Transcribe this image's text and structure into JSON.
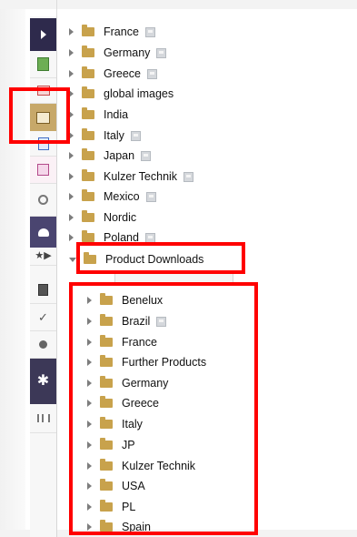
{
  "tree": {
    "top_items": [
      {
        "label": "France",
        "locked": true
      },
      {
        "label": "Germany",
        "locked": true
      },
      {
        "label": "Greece",
        "locked": true
      },
      {
        "label": "global images",
        "locked": false
      },
      {
        "label": "India",
        "locked": false
      },
      {
        "label": "Italy",
        "locked": true
      },
      {
        "label": "Japan",
        "locked": true
      },
      {
        "label": "Kulzer Technik",
        "locked": true
      },
      {
        "label": "Mexico",
        "locked": true
      },
      {
        "label": "Nordic",
        "locked": false
      },
      {
        "label": "Poland",
        "locked": true
      }
    ],
    "expanded_folder": {
      "label": "Product Downloads",
      "expanded": true
    },
    "sub_items": [
      {
        "label": "Benelux",
        "locked": false
      },
      {
        "label": "Brazil",
        "locked": true
      },
      {
        "label": "France",
        "locked": false
      },
      {
        "label": "Further Products",
        "locked": false
      },
      {
        "label": "Germany",
        "locked": false
      },
      {
        "label": "Greece",
        "locked": false
      },
      {
        "label": "Italy",
        "locked": false
      },
      {
        "label": "JP",
        "locked": false
      },
      {
        "label": "Kulzer Technik",
        "locked": false
      },
      {
        "label": "USA",
        "locked": false
      },
      {
        "label": "PL",
        "locked": false
      },
      {
        "label": "Spain",
        "locked": false
      }
    ]
  },
  "sidebar": {
    "buttons": [
      "expand-icon",
      "documents-icon",
      "comments-icon",
      "media-icon",
      "forms-icon",
      "notes-icon",
      "settings-icon",
      "users-icon",
      "favorites-icon",
      "pages-icon",
      "check-icon",
      "record-icon",
      "plugins-icon",
      "reports-icon"
    ]
  },
  "colors": {
    "folder": "#c8a24c",
    "highlight": "#ff0000",
    "sidebar_dark": "#2e2a4c",
    "sidebar_gold": "#c7a869"
  }
}
